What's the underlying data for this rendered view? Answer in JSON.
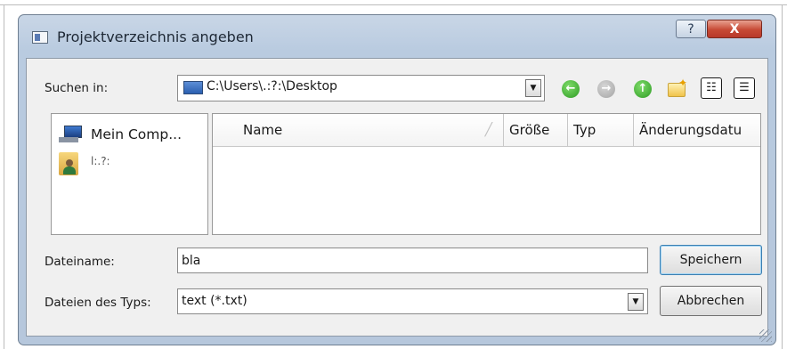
{
  "dialog": {
    "title": "Projektverzeichnis angeben",
    "help_glyph": "?",
    "close_glyph": "X"
  },
  "toolbar": {
    "look_in_label": "Suchen in:",
    "look_in_value": "C:\\Users\\.:?:\\Desktop",
    "icons": [
      "back-icon",
      "forward-icon",
      "up-folder-icon",
      "new-folder-icon",
      "list-view-icon",
      "detail-view-icon"
    ],
    "back_glyph": "←",
    "forward_glyph": "→",
    "up_glyph": "↑",
    "new_folder_glyph": "✦",
    "list_view_glyph": "☷",
    "detail_view_glyph": "☰"
  },
  "sidebar": {
    "items": [
      {
        "label": "Mein Comp...",
        "icon": "computer-icon"
      },
      {
        "label": "l:.?:",
        "icon": "user-folder-icon"
      }
    ]
  },
  "file_list": {
    "columns": [
      "Name",
      "Größe",
      "Typ",
      "Änderungsdatu"
    ],
    "sort_glyph": "╱",
    "rows": []
  },
  "filename": {
    "label": "Dateiname:",
    "value": "bla"
  },
  "filetype": {
    "label": "Dateien des Typs:",
    "value": "text (*.txt)"
  },
  "buttons": {
    "save": "Speichern",
    "cancel": "Abbrechen"
  },
  "colors": {
    "titlebar": "#c9d6e6",
    "close_button": "#c74a35",
    "default_button_border": "#3c7fb1",
    "nav_green": "#2e9b24"
  }
}
